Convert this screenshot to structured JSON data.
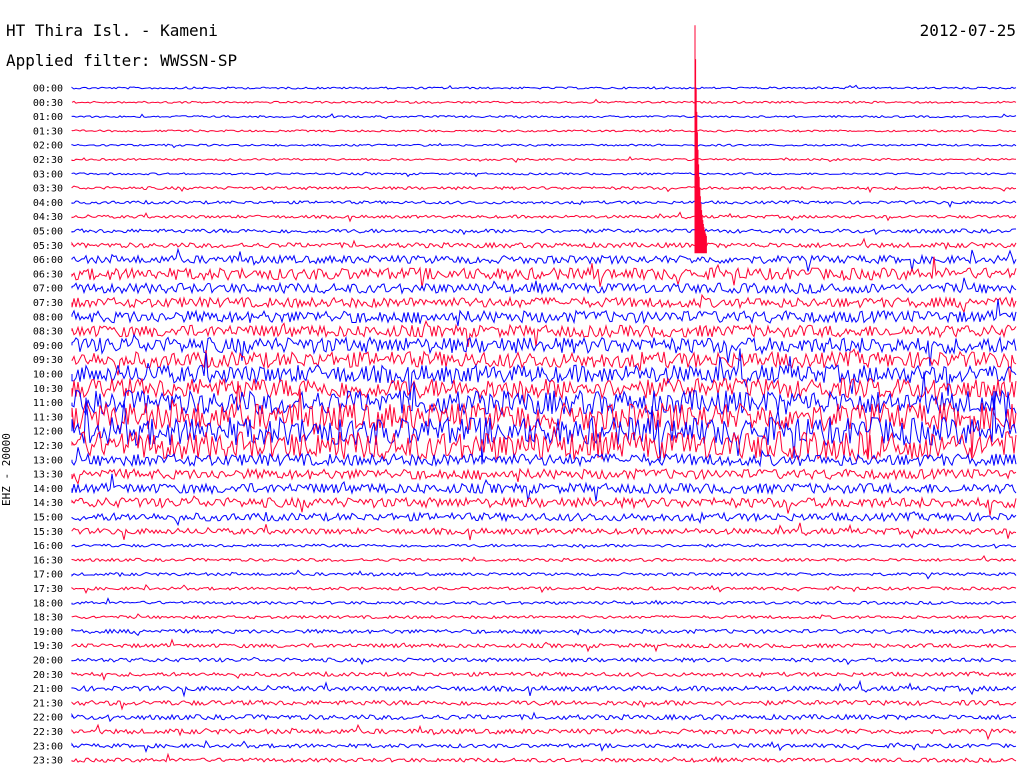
{
  "header": {
    "station": "HT Thira Isl. - Kameni",
    "filter": "Applied filter: WWSSN-SP",
    "date": "2012-07-25"
  },
  "chart_data": {
    "type": "line",
    "title": "HT Thira Isl. - Kameni",
    "subtitle": "Applied filter: WWSSN-SP",
    "ylabel": "EHZ - 20000",
    "xlabel": "",
    "row_labels": [
      "00:00",
      "00:30",
      "01:00",
      "01:30",
      "02:00",
      "02:30",
      "03:00",
      "03:30",
      "04:00",
      "04:30",
      "05:00",
      "05:30",
      "06:00",
      "06:30",
      "07:00",
      "07:30",
      "08:00",
      "08:30",
      "09:00",
      "09:30",
      "10:00",
      "10:30",
      "11:00",
      "11:30",
      "12:00",
      "12:30",
      "13:00",
      "13:30",
      "14:00",
      "14:30",
      "15:00",
      "15:30",
      "16:00",
      "16:30",
      "17:00",
      "17:30",
      "18:00",
      "18:30",
      "19:00",
      "19:30",
      "20:00",
      "20:30",
      "21:00",
      "21:30",
      "22:00",
      "22:30",
      "23:00",
      "23:30"
    ],
    "series_colors": [
      "#0000ff",
      "#ff0033"
    ],
    "trace_amplitude": [
      1,
      1,
      1,
      1,
      1,
      1,
      1,
      1.5,
      1.5,
      1.5,
      2,
      2.5,
      4,
      6,
      5,
      5,
      6,
      6,
      8,
      8,
      9,
      10,
      12,
      14,
      14,
      14,
      6,
      5,
      5,
      5,
      4,
      3,
      1.5,
      1.5,
      1.5,
      1.5,
      1.5,
      1.5,
      2,
      2,
      2,
      2,
      2.5,
      2.5,
      2.5,
      2.5,
      2,
      2
    ],
    "events": [
      {
        "time": "05:30",
        "minute_in_window": 19.8,
        "type": "earthquake"
      }
    ]
  }
}
